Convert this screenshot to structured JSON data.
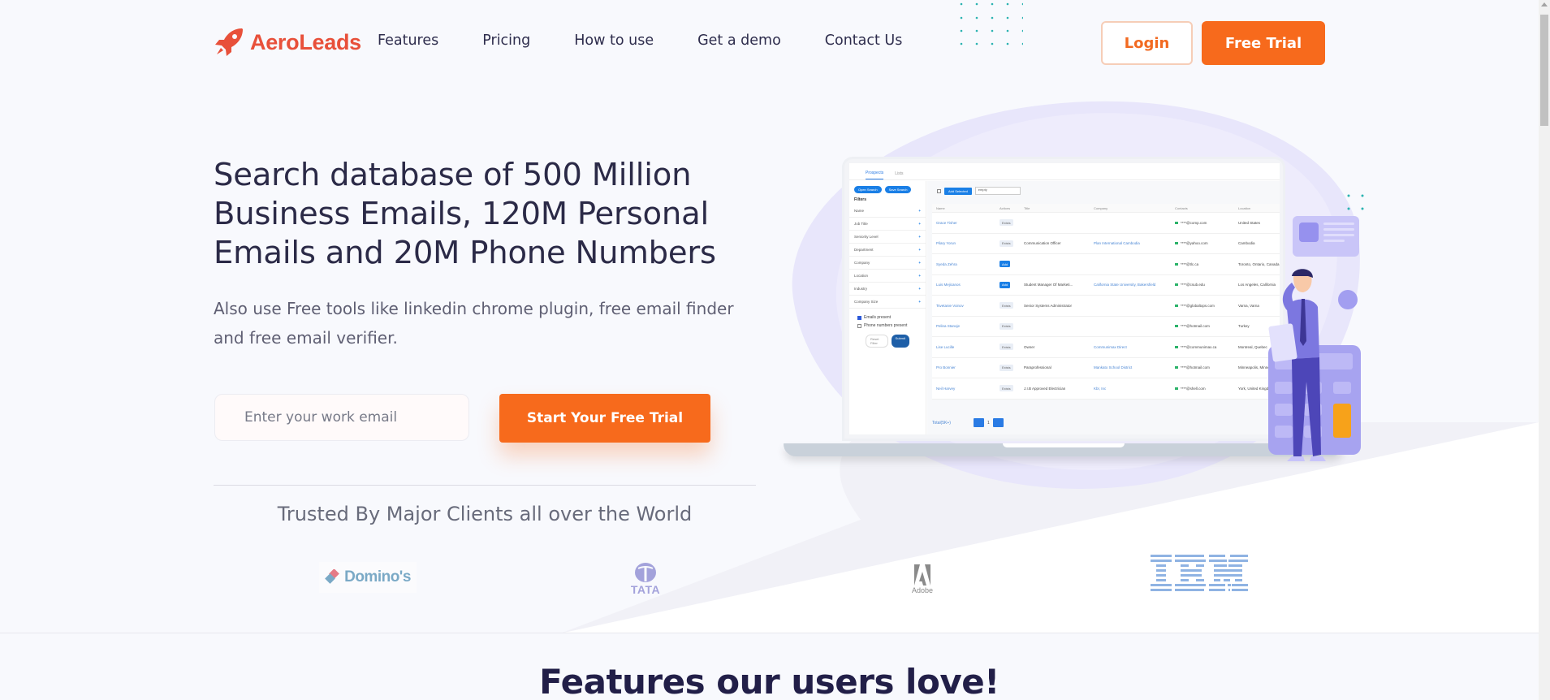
{
  "brand": {
    "name": "AeroLeads",
    "color": "#e8503a",
    "accent": "#f76a1c"
  },
  "nav": {
    "items": [
      "Features",
      "Pricing",
      "How to use",
      "Get a demo",
      "Contact Us"
    ],
    "login_label": "Login",
    "trial_label": "Free Trial"
  },
  "hero": {
    "title": "Search database of 500 Million Business Emails, 120M Personal Emails and 20M Phone Numbers",
    "subtitle": "Also use Free tools like linkedin chrome plugin, free email finder and free email verifier.",
    "email_placeholder": "Enter your work email",
    "email_value": "",
    "cta_label": "Start Your Free Trial"
  },
  "trusted": {
    "heading": "Trusted By Major Clients all over the World",
    "logos": [
      "Domino's",
      "TATA",
      "Adobe",
      "IBM"
    ]
  },
  "app_mock": {
    "tabs": [
      "Prospects",
      "Lists"
    ],
    "open_search": "Open Search",
    "save_search": "Save Search",
    "filters_label": "Filters",
    "filters": [
      "Name",
      "Job Title",
      "Seniority Level",
      "Department",
      "Company",
      "Location",
      "Industry",
      "Company Size"
    ],
    "checkboxes": [
      {
        "label": "Emails present",
        "checked": true
      },
      {
        "label": "Phone numbers present",
        "checked": false
      }
    ],
    "reset_label": "Reset Filter",
    "submit_label": "Submit",
    "add_selected": "Add Selected",
    "list_select": "empty",
    "columns": [
      "Name",
      "Actions",
      "Title",
      "Company",
      "Contacts",
      "Location"
    ],
    "rows": [
      {
        "name": "Grace Tisher",
        "action": "Exists",
        "title": "",
        "company": "",
        "contact": "****@comp.com",
        "location": "United States"
      },
      {
        "name": "Pilary Yorun",
        "action": "Exists",
        "title": "Communication Officer",
        "company": "Plan International Cambodia",
        "contact": "****@yahoo.com",
        "location": "Cambodia"
      },
      {
        "name": "Syeda Zehra",
        "action": "Add",
        "title": "",
        "company": "",
        "contact": "****@tlc.ca",
        "location": "Toronto, Ontario, Canada"
      },
      {
        "name": "Luis Mejicanos",
        "action": "Add",
        "title": "Student Manager Of Marketi...",
        "company": "California State University, Bakersfield",
        "contact": "****@csub.edu",
        "location": "Los Angeles, California"
      },
      {
        "name": "Tsvetanie Voinov",
        "action": "Exists",
        "title": "Senior Systems Administrator",
        "company": "",
        "contact": "****@globaltops.com",
        "location": "Varna, Varna"
      },
      {
        "name": "Pelina Stanoje",
        "action": "Exists",
        "title": "",
        "company": "",
        "contact": "****@hotmail.com",
        "location": "Turkey"
      },
      {
        "name": "Lise Lucille",
        "action": "Exists",
        "title": "Owner",
        "company": "Communimax Direct",
        "contact": "****@communimax.ca",
        "location": "Montreal, Quebec"
      },
      {
        "name": "Pro Bonnier",
        "action": "Exists",
        "title": "Paraprofessional",
        "company": "Mankato School District",
        "contact": "****@hotmail.com",
        "location": "Minneapolis, Minnesota"
      },
      {
        "name": "Neil Harvey",
        "action": "Exists",
        "title": "J.I.B Approved Electrician",
        "company": "Kbr, Inc",
        "contact": "****@shell.com",
        "location": "York, United Kingdom"
      }
    ],
    "total_label": "Total(5K+)",
    "page": "1"
  },
  "features_heading": "Features our users love!"
}
